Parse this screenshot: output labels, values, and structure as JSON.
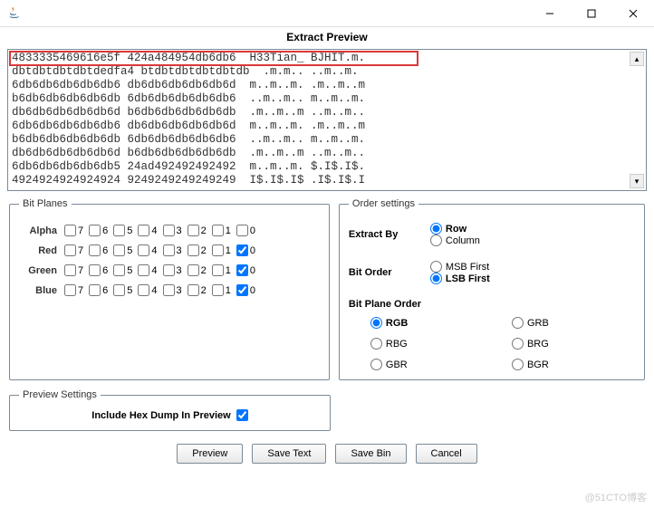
{
  "title_spacer": "",
  "header": "Extract Preview",
  "preview_text": "4833335469616e5f 424a484954db6db6  H33Tian_ BJHIT.m.\ndbtdbtdbtdbtdedfa4 btdbtdbtdbtdbtdb  .m.m.. ..m..m.\n6db6db6db6db6db6 db6db6db6db6db6d  m..m..m. .m..m..m\nb6db6db6db6db6db 6db6db6db6db6db6  ..m..m.. m..m..m.\ndb6db6db6db6db6d b6db6db6db6db6db  .m..m..m ..m..m..\n6db6db6db6db6db6 db6db6db6db6db6d  m..m..m. .m..m..m\nb6db6db6db6db6db 6db6db6db6db6db6  ..m..m.. m..m..m.\ndb6db6db6db6db6d b6db6db6db6db6db  .m..m..m ..m..m..\n6db6db6db6db6db5 24ad492492492492  m..m..m. $.I$.I$.\n4924924924924924 9249249249249249  I$.I$.I$ .I$.I$.I",
  "bitplanes": {
    "legend": "Bit Planes",
    "channels": [
      "Alpha",
      "Red",
      "Green",
      "Blue"
    ],
    "bits": [
      "7",
      "6",
      "5",
      "4",
      "3",
      "2",
      "1",
      "0"
    ],
    "checked": {
      "Alpha": [],
      "Red": [
        "0"
      ],
      "Green": [
        "0"
      ],
      "Blue": [
        "0"
      ]
    }
  },
  "order_settings": {
    "legend": "Order settings",
    "extract_by_label": "Extract By",
    "extract_by": {
      "options": [
        "Row",
        "Column"
      ],
      "selected": "Row"
    },
    "bit_order_label": "Bit Order",
    "bit_order": {
      "options": [
        "MSB First",
        "LSB First"
      ],
      "selected": "LSB First"
    },
    "plane_order_label": "Bit Plane Order",
    "plane_order": {
      "options": [
        "RGB",
        "GRB",
        "RBG",
        "BRG",
        "GBR",
        "BGR"
      ],
      "selected": "RGB"
    }
  },
  "preview_settings": {
    "legend": "Preview Settings",
    "include_hex_label": "Include Hex Dump In Preview",
    "include_hex_checked": true
  },
  "buttons": {
    "preview": "Preview",
    "save_text": "Save Text",
    "save_bin": "Save Bin",
    "cancel": "Cancel"
  },
  "watermark": "@51CTO博客"
}
